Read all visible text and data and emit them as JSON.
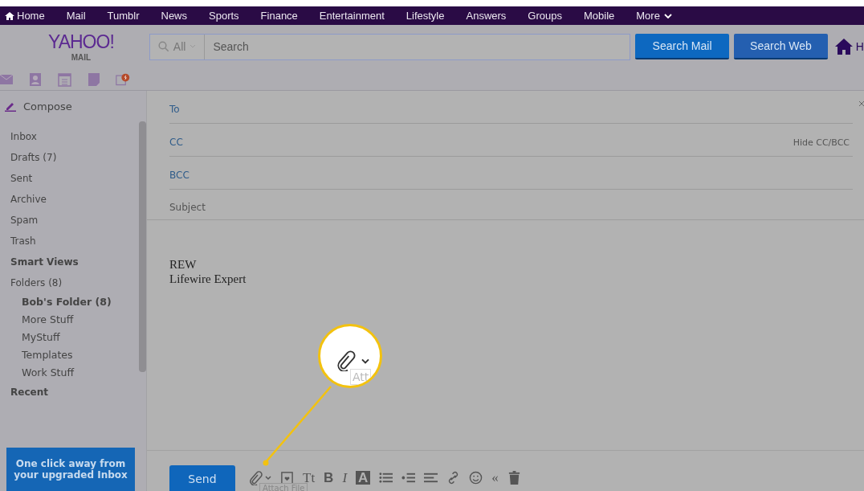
{
  "top_nav": [
    {
      "label": "Home",
      "kind": "home"
    },
    {
      "label": "Mail",
      "kind": "link"
    },
    {
      "label": "Tumblr",
      "kind": "link"
    },
    {
      "label": "News",
      "kind": "link"
    },
    {
      "label": "Sports",
      "kind": "link"
    },
    {
      "label": "Finance",
      "kind": "link"
    },
    {
      "label": "Entertainment",
      "kind": "link"
    },
    {
      "label": "Lifestyle",
      "kind": "link"
    },
    {
      "label": "Answers",
      "kind": "link"
    },
    {
      "label": "Groups",
      "kind": "link"
    },
    {
      "label": "Mobile",
      "kind": "link"
    },
    {
      "label": "More",
      "kind": "more"
    }
  ],
  "logo": {
    "brand": "YAHOO!",
    "product": "MAIL"
  },
  "search": {
    "scope": "All",
    "placeholder": "Search"
  },
  "search_buttons": [
    "Search Mail",
    "Search Web"
  ],
  "home_label": "H",
  "compose_label": "Compose",
  "sidebar": {
    "items": [
      {
        "label": "Inbox",
        "kind": "folder"
      },
      {
        "label": "Drafts (7)",
        "kind": "folder"
      },
      {
        "label": "Sent",
        "kind": "folder"
      },
      {
        "label": "Archive",
        "kind": "folder"
      },
      {
        "label": "Spam",
        "kind": "folder"
      },
      {
        "label": "Trash",
        "kind": "folder"
      },
      {
        "label": "Smart Views",
        "kind": "heading"
      },
      {
        "label": "Folders (8)",
        "kind": "folder"
      },
      {
        "label": "Bob's Folder  (8)",
        "kind": "subfolder-bold"
      },
      {
        "label": "More Stuff",
        "kind": "subfolder"
      },
      {
        "label": "MyStuff",
        "kind": "subfolder"
      },
      {
        "label": "Templates",
        "kind": "subfolder"
      },
      {
        "label": "Work Stuff",
        "kind": "subfolder"
      },
      {
        "label": "Recent",
        "kind": "heading"
      }
    ],
    "promo": "One click away from your upgraded Inbox"
  },
  "fields": [
    {
      "label": "To"
    },
    {
      "label": "CC",
      "action": "Hide CC/BCC"
    },
    {
      "label": "BCC"
    },
    {
      "label": "Subject"
    }
  ],
  "body_lines": [
    "REW",
    "Lifewire Expert"
  ],
  "send": "Send",
  "toolbar": [
    {
      "kind": "attach"
    },
    {
      "kind": "stationery"
    },
    {
      "kind": "text",
      "label": "Tt"
    },
    {
      "kind": "bold",
      "label": "B"
    },
    {
      "kind": "italic",
      "label": "I"
    },
    {
      "kind": "highlight",
      "label": "A"
    },
    {
      "kind": "bullets"
    },
    {
      "kind": "indent"
    },
    {
      "kind": "align"
    },
    {
      "kind": "link"
    },
    {
      "kind": "emoji"
    },
    {
      "kind": "text",
      "label": "«"
    },
    {
      "kind": "trash"
    }
  ],
  "tooltip": "Attach File",
  "callout": {
    "tooltip": "Att"
  }
}
